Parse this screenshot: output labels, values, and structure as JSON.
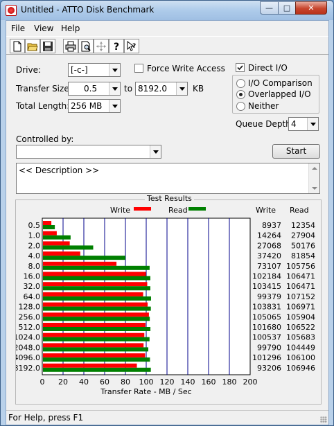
{
  "window": {
    "title": "Untitled - ATTO Disk Benchmark"
  },
  "menu": {
    "items": [
      "File",
      "View",
      "Help"
    ]
  },
  "toolbar": {
    "icons": [
      "new-icon",
      "open-icon",
      "save-icon",
      "print-icon",
      "print-preview-icon",
      "move-icon",
      "help-icon",
      "context-help-icon"
    ]
  },
  "form": {
    "drive_label": "Drive:",
    "drive_value": "[-c-]",
    "force_write_label": "Force Write Access",
    "direct_io_label": "Direct I/O",
    "transfer_size_label": "Transfer Size:",
    "transfer_from": "0.5",
    "to_label": "to",
    "transfer_to": "8192.0",
    "kb_label": "KB",
    "total_length_label": "Total Length:",
    "total_length_value": "256 MB",
    "io_comparison_label": "I/O Comparison",
    "overlapped_io_label": "Overlapped I/O",
    "neither_label": "Neither",
    "queue_depth_label": "Queue Depth:",
    "queue_depth_value": "4",
    "controlled_by_label": "Controlled by:",
    "controlled_by_value": "",
    "start_label": "Start",
    "description_text": "<< Description >>"
  },
  "results": {
    "title": "Test Results",
    "legend_write": "Write",
    "legend_read": "Read",
    "col_write": "Write",
    "col_read": "Read",
    "write_color": "#ff0000",
    "read_color": "#008000",
    "axis_label": "Transfer Rate - MB / Sec"
  },
  "chart_data": {
    "type": "bar",
    "orientation": "horizontal",
    "title": "Test Results",
    "xlabel": "Transfer Rate - MB / Sec",
    "xlim": [
      0,
      200
    ],
    "xticks": [
      0,
      20,
      40,
      60,
      80,
      100,
      120,
      140,
      160,
      180,
      200
    ],
    "grid": true,
    "legend": "top",
    "categories": [
      "0.5",
      "1.0",
      "2.0",
      "4.0",
      "8.0",
      "16.0",
      "32.0",
      "64.0",
      "128.0",
      "256.0",
      "512.0",
      "1024.0",
      "2048.0",
      "4096.0",
      "8192.0"
    ],
    "series": [
      {
        "name": "Write",
        "color": "#ff0000",
        "values": [
          8937,
          14264,
          27068,
          37420,
          73107,
          102184,
          103415,
          99379,
          103831,
          105065,
          101680,
          100537,
          99790,
          101296,
          93206
        ]
      },
      {
        "name": "Read",
        "color": "#008000",
        "values": [
          12354,
          27904,
          50176,
          81854,
          105756,
          106471,
          106471,
          107152,
          106971,
          105904,
          106522,
          105683,
          104449,
          106100,
          106946
        ]
      }
    ]
  },
  "status": {
    "text": "For Help, press F1"
  }
}
